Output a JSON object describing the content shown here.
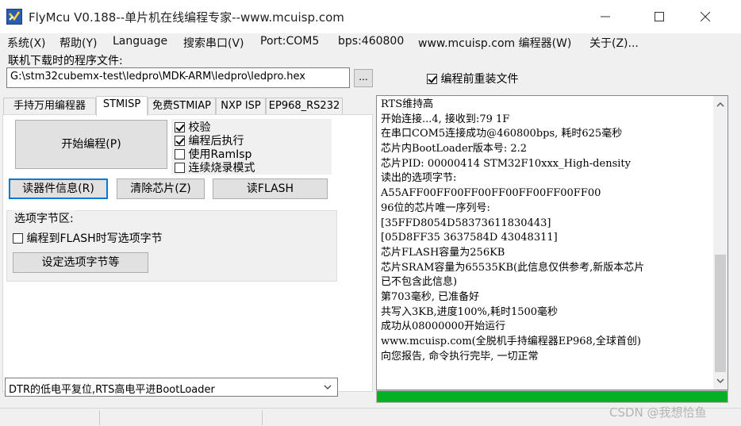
{
  "window": {
    "title": "FlyMcu V0.188--单片机在线编程专家--www.mcuisp.com"
  },
  "menu": {
    "items": [
      "系统(X)",
      "帮助(Y)",
      "Language",
      "搜索串口(V)",
      "Port:COM5",
      "bps:460800",
      "www.mcuisp.com 编程器(W)",
      "关于(Z)..."
    ]
  },
  "file": {
    "label": "联机下载时的程序文件:",
    "path": "G:\\stm32cubemx-test\\ledpro\\MDK-ARM\\ledpro\\ledpro.hex",
    "browse_label": "...",
    "reload_label": "编程前重装文件",
    "reload_checked": true
  },
  "tabs": {
    "items": [
      "手持万用编程器",
      "STMISP",
      "免费STMIAP",
      "NXP ISP",
      "EP968_RS232"
    ],
    "active": "STMISP"
  },
  "stmisp": {
    "start_label": "开始编程(P)",
    "options": [
      {
        "label": "校验",
        "checked": true
      },
      {
        "label": "编程后执行",
        "checked": true
      },
      {
        "label": "使用RamIsp",
        "checked": false
      },
      {
        "label": "连续烧录模式",
        "checked": false
      }
    ],
    "read_info_label": "读器件信息(R)",
    "erase_label": "清除芯片(Z)",
    "read_flash_label": "读FLASH",
    "option_group_label": "选项字节区:",
    "write_option_label": "编程到FLASH时写选项字节",
    "write_option_checked": false,
    "set_option_label": "设定选项字节等"
  },
  "boot_mode": {
    "selected": "DTR的低电平复位,RTS高电平进BootLoader"
  },
  "log": {
    "lines": [
      "RTS维持高",
      "开始连接...4, 接收到:79 1F",
      "在串口COM5连接成功@460800bps, 耗时625毫秒",
      "芯片内BootLoader版本号: 2.2",
      "芯片PID: 00000414  STM32F10xxx_High-density",
      "读出的选项字节:",
      "A55AFF00FF00FF00FF00FF00FF00FF00",
      "96位的芯片唯一序列号:",
      "[35FFD8054D58373611830443]",
      "[05D8FF35 3637584D 43048311]",
      "芯片FLASH容量为256KB",
      "芯片SRAM容量为65535KB(此信息仅供参考,新版本芯片",
      "已不包含此信息)",
      "第703毫秒, 已准备好",
      "共写入3KB,进度100%,耗时1500毫秒",
      "成功从08000000开始运行",
      "www.mcuisp.com(全脱机手持编程器EP968,全球首创)",
      "向您报告, 命令执行完毕, 一切正常"
    ]
  },
  "progress": {
    "fraction": 1.0,
    "color": "#06b025"
  },
  "watermark": "CSDN @我想恰鱼"
}
